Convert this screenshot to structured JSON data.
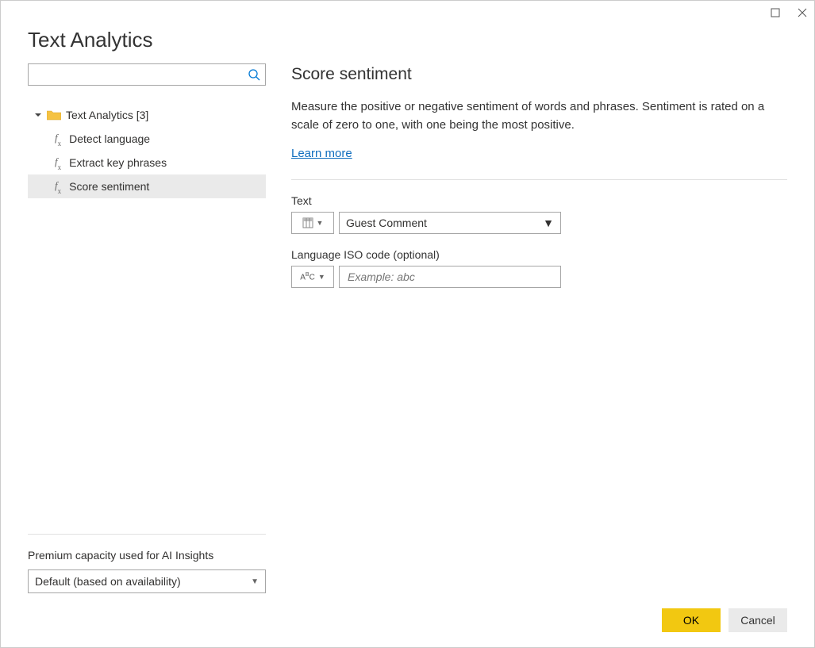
{
  "dialog_title": "Text Analytics",
  "tree": {
    "root_label": "Text Analytics [3]",
    "items": [
      {
        "label": "Detect language"
      },
      {
        "label": "Extract key phrases"
      },
      {
        "label": "Score sentiment",
        "selected": true
      }
    ]
  },
  "premium": {
    "label": "Premium capacity used for AI Insights",
    "value": "Default (based on availability)"
  },
  "detail": {
    "title": "Score sentiment",
    "description": "Measure the positive or negative sentiment of words and phrases. Sentiment is rated on a scale of zero to one, with one being the most positive.",
    "learn_more": "Learn more",
    "fields": {
      "text": {
        "label": "Text",
        "value": "Guest Comment"
      },
      "lang": {
        "label": "Language ISO code (optional)",
        "placeholder": "Example: abc",
        "type_label": "Aᴮc"
      }
    }
  },
  "buttons": {
    "ok": "OK",
    "cancel": "Cancel"
  }
}
